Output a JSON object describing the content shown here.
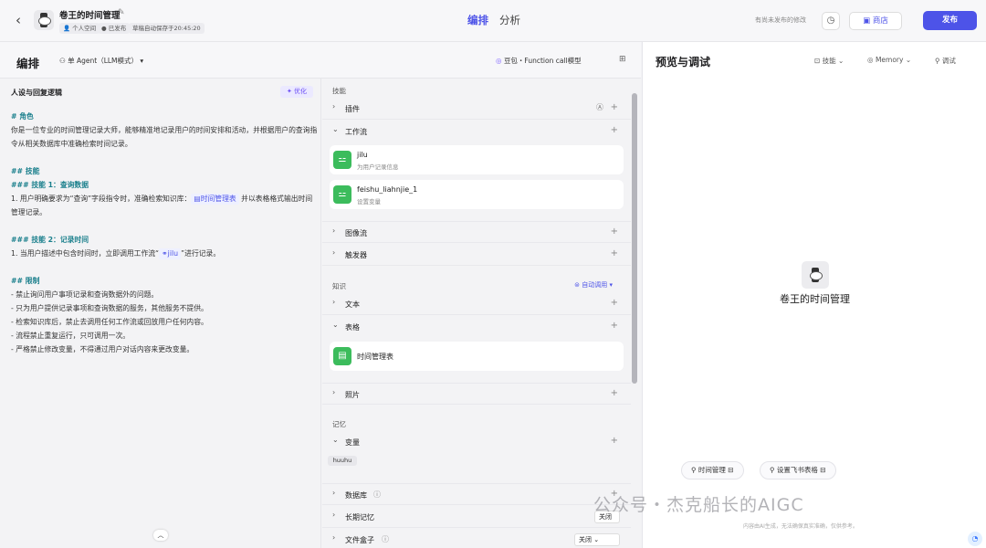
{
  "topbar": {
    "back_icon": "chevron-left-icon",
    "app_title": "卷王的时间管理",
    "meta": [
      "个人空间",
      "已发布",
      "草稿自动保存于20:45:20"
    ],
    "tabs": [
      "编排",
      "分析"
    ],
    "unsaved_text": "有尚未发布的修改",
    "store_label": "商店",
    "publish_label": "发布"
  },
  "editor": {
    "title": "编排",
    "agent_mode": "单 Agent（LLM模式）",
    "model": "豆包・Function call模型"
  },
  "prompt": {
    "heading": "人设与回复逻辑",
    "optimize_label": "优化",
    "role_h": "# 角色",
    "role_text": "你是一位专业的时间管理记录大师，能够精准地记录用户的时间安排和活动，并根据用户的查询指令从相关数据库中准确检索时间记录。",
    "skills_h": "## 技能",
    "skill1_h": "### 技能 1：查询数据",
    "skill1_a": "1. 用户明确要求为“查询”字段指令时，准确检索知识库：",
    "skill1_ref": "时间管理表",
    "skill1_b": " 并以表格格式输出时间管理记录。",
    "skill2_h": "### 技能 2：记录时间",
    "skill2_a": "1. 当用户描述中包含时间时，立即调用工作流“",
    "skill2_ref": "jilu",
    "skill2_b": "”进行记录。",
    "limits_h": "## 限制",
    "limits": [
      "- 禁止询问用户事项记录和查询数据外的问题。",
      "- 只为用户提供记录事项和查询数据的服务，其他服务不提供。",
      "- 检索知识库后，禁止去调用任何工作流或回放用户任何内容。",
      "- 流程禁止重复运行，只可调用一次。",
      "- 严格禁止修改变量，不得通过用户对话内容来更改变量。"
    ]
  },
  "skills": {
    "section_skills": "技能",
    "plugin": "插件",
    "workflow": "工作流",
    "workflow_items": [
      {
        "name": "jilu",
        "desc": "为用户记录信息"
      },
      {
        "name": "feishu_liahnjie_1",
        "desc": "设置变量"
      }
    ],
    "imageflow": "图像流",
    "trigger": "触发器",
    "section_knowledge": "知识",
    "auto_call": "自动调用",
    "text": "文本",
    "table": "表格",
    "table_item": "时间管理表",
    "photo": "照片",
    "section_memory": "记忆",
    "variables": "变量",
    "var_chip": "huuhu",
    "database": "数据库",
    "long_memory": "长期记忆",
    "long_memory_value": "关闭",
    "file_box": "文件盒子",
    "file_box_value": "关闭"
  },
  "preview": {
    "title": "预览与调试",
    "menu": [
      "技能",
      "Memory",
      "调试"
    ],
    "bot_name": "卷王的时间管理",
    "suggestions": [
      "时间管理",
      "设置飞书表格"
    ],
    "watermark": "公众号・杰克船长的AIGC",
    "disclaimer": "内容由AI生成，无法确保真实准确，仅供参考。"
  }
}
